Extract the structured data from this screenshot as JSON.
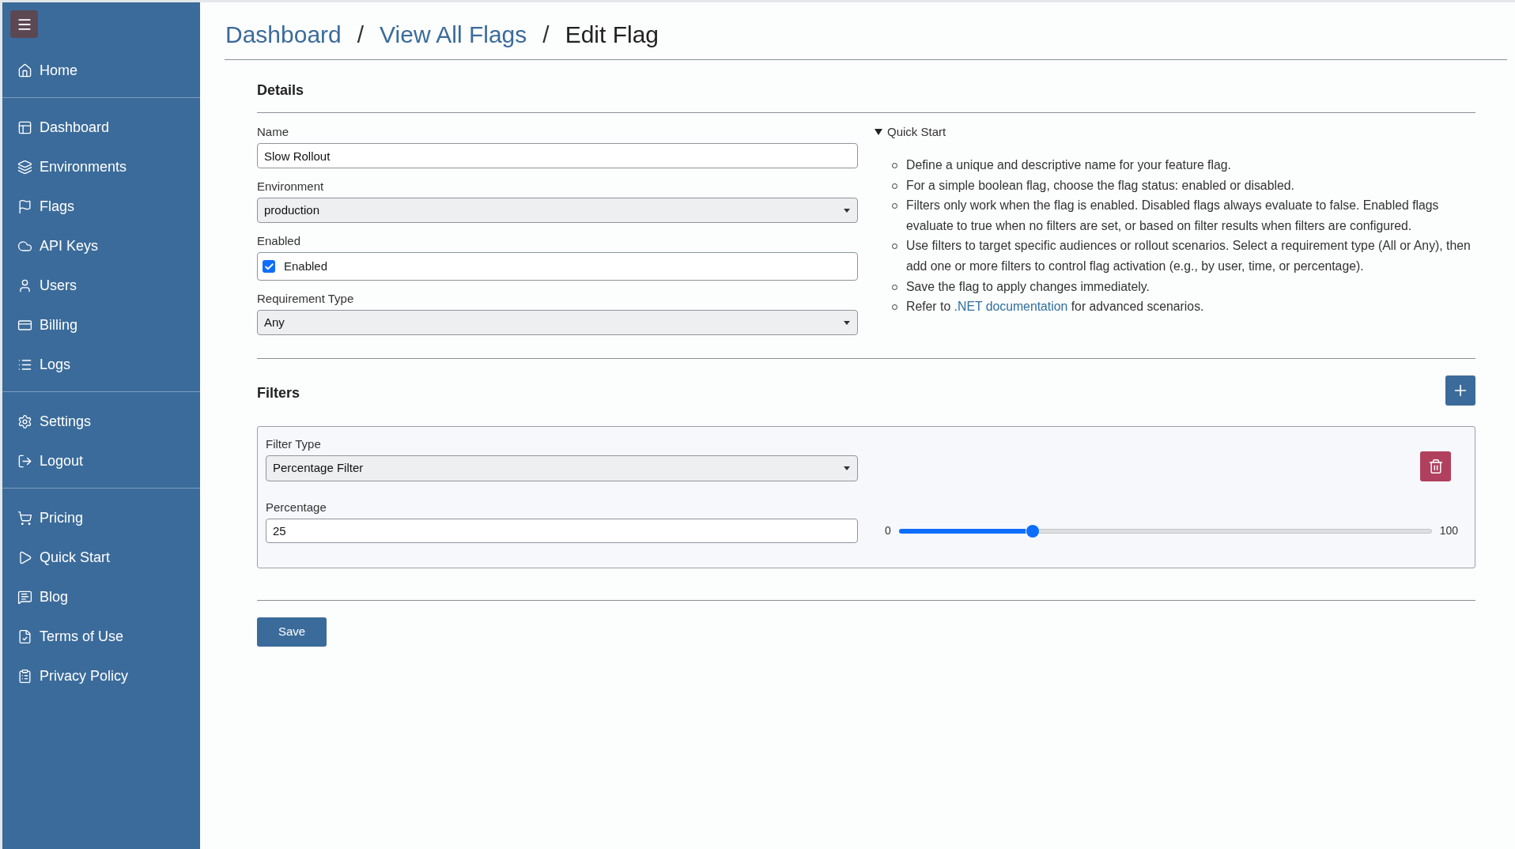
{
  "sidebar": {
    "groups": [
      {
        "items": [
          {
            "label": "Home"
          }
        ]
      },
      {
        "items": [
          {
            "label": "Dashboard"
          },
          {
            "label": "Environments"
          },
          {
            "label": "Flags"
          },
          {
            "label": "API Keys"
          },
          {
            "label": "Users"
          },
          {
            "label": "Billing"
          },
          {
            "label": "Logs"
          }
        ]
      },
      {
        "items": [
          {
            "label": "Settings"
          },
          {
            "label": "Logout"
          }
        ]
      },
      {
        "items": [
          {
            "label": "Pricing"
          },
          {
            "label": "Quick Start"
          },
          {
            "label": "Blog"
          },
          {
            "label": "Terms of Use"
          },
          {
            "label": "Privacy Policy"
          }
        ]
      }
    ]
  },
  "breadcrumb": [
    {
      "kind": "link",
      "label": "Dashboard"
    },
    {
      "kind": "separator",
      "label": "/"
    },
    {
      "kind": "link",
      "label": "View All Flags"
    },
    {
      "kind": "separator",
      "label": "/"
    },
    {
      "kind": "current",
      "label": "Edit Flag"
    }
  ],
  "details": {
    "title": "Details",
    "fields": [
      {
        "kind": "text",
        "label": "Name",
        "value": "Slow Rollout"
      },
      {
        "kind": "select",
        "label": "Environment",
        "value": "production"
      },
      {
        "kind": "checkbox",
        "label": "Enabled",
        "option": "Enabled",
        "checked": true
      },
      {
        "kind": "select",
        "label": "Requirement Type",
        "value": "Any"
      }
    ]
  },
  "quick_start": {
    "title": "Quick Start",
    "expanded": true,
    "items": [
      {
        "kind": "text",
        "text": "Define a unique and descriptive name for your feature flag."
      },
      {
        "kind": "text",
        "text": "For a simple boolean flag, choose the flag status: enabled or disabled."
      },
      {
        "kind": "text",
        "text": "Filters only work when the flag is enabled. Disabled flags always evaluate to false. Enabled flags evaluate to true when no filters are set, or based on filter results when filters are configured."
      },
      {
        "kind": "text",
        "text": "Use filters to target specific audiences or rollout scenarios. Select a requirement type (All or Any), then add one or more filters to control flag activation (e.g., by user, time, or percentage)."
      },
      {
        "kind": "text",
        "text": "Save the flag to apply changes immediately."
      },
      {
        "kind": "link",
        "before": "Refer to",
        "link": ".NET documentation",
        "after": "for advanced scenarios."
      }
    ]
  },
  "filters": {
    "title": "Filters",
    "items": [
      {
        "type_label": "Filter Type",
        "type_value": "Percentage Filter",
        "percentage_label": "Percentage",
        "percentage_value": "25",
        "slider": {
          "min_label": "0",
          "max_label": "100",
          "level": 0.25
        }
      }
    ]
  },
  "save_button": "Save"
}
